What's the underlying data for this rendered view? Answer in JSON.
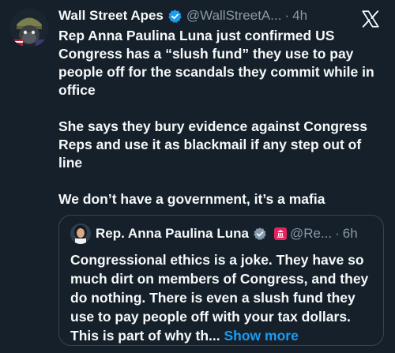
{
  "tweet": {
    "author_name": "Wall Street Apes",
    "handle": "@WallStreetA...",
    "separator": "·",
    "time": "4h",
    "paragraphs": [
      "Rep Anna Paulina Luna just confirmed US Congress has a “slush fund” they use to pay people off for the scandals they commit while in office",
      "She says they bury evidence against Congress Reps and use it as blackmail if any step out of line",
      "We don’t have a government, it’s a mafia"
    ]
  },
  "quote": {
    "author_name": "Rep. Anna Paulina Luna",
    "handle": "@Re...",
    "separator": "·",
    "time": "6h",
    "text": "Congressional ethics is a joke. They have so much dirt on members of Congress, and they do nothing. There is even a slush fund they use to pay people off with your tax dollars. This is part of why th...",
    "show_more": "Show more"
  },
  "colors": {
    "background": "#15202b",
    "text": "#f7f9f9",
    "muted": "#8b98a5",
    "accent": "#1d9bf0",
    "border": "#38444d"
  },
  "icons": {
    "app_logo": "x-logo-icon",
    "verified": "verified-badge-icon"
  }
}
